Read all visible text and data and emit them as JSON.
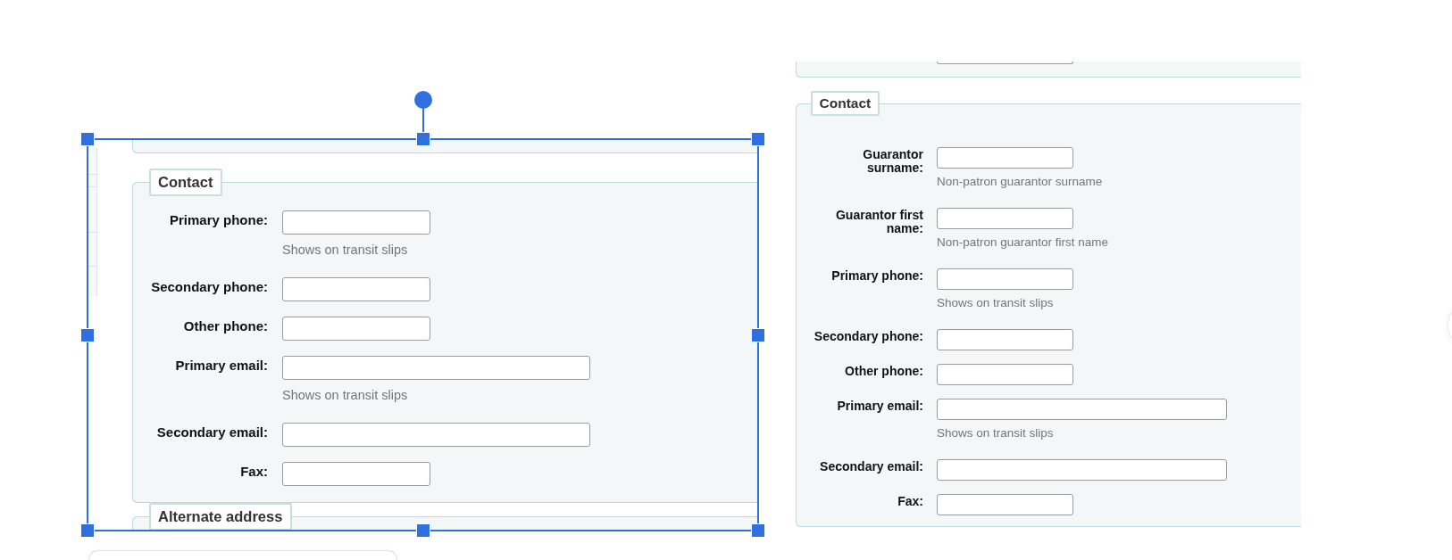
{
  "canvas": {
    "images": [
      {
        "selected": true,
        "sections": [
          {
            "legend": "Contact",
            "fields": [
              {
                "label": "Primary phone:",
                "kind": "short",
                "hint": "Shows on transit slips"
              },
              {
                "label": "Secondary phone:",
                "kind": "short"
              },
              {
                "label": "Other phone:",
                "kind": "short"
              },
              {
                "label": "Primary email:",
                "kind": "long",
                "hint": "Shows on transit slips"
              },
              {
                "label": "Secondary email:",
                "kind": "long"
              },
              {
                "label": "Fax:",
                "kind": "short"
              }
            ]
          },
          {
            "legend": "Alternate address"
          }
        ]
      },
      {
        "selected": false,
        "sections": [
          {
            "legend": "Contact",
            "fields": [
              {
                "label": "Guarantor surname:",
                "kind": "short",
                "hint": "Non-patron guarantor surname"
              },
              {
                "label": "Guarantor first name:",
                "kind": "short",
                "hint": "Non-patron guarantor first name"
              },
              {
                "label": "Primary phone:",
                "kind": "short",
                "hint": "Shows on transit slips"
              },
              {
                "label": "Secondary phone:",
                "kind": "short"
              },
              {
                "label": "Other phone:",
                "kind": "short"
              },
              {
                "label": "Primary email:",
                "kind": "long",
                "hint": "Shows on transit slips"
              },
              {
                "label": "Secondary email:",
                "kind": "long"
              },
              {
                "label": "Fax:",
                "kind": "short"
              }
            ]
          }
        ]
      }
    ]
  }
}
